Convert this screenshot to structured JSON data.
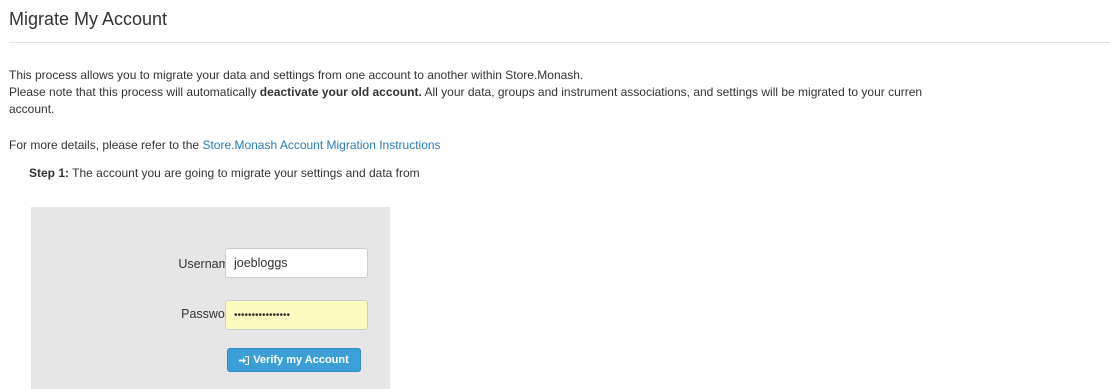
{
  "page": {
    "title": "Migrate My Account"
  },
  "intro": {
    "line1": "This process allows you to migrate your data and settings from one account to another within Store.Monash.",
    "line2_before": "Please note that this process will automatically ",
    "line2_bold": "deactivate your old account.",
    "line2_after": " All your data, groups and instrument associations, and settings will be migrated to your curren",
    "line3": "account."
  },
  "details": {
    "prefix": "For more details, please refer to the ",
    "link_text": "Store.Monash Account Migration Instructions"
  },
  "step": {
    "label": "Step 1:",
    "text": " The account you are going to migrate your settings and data from"
  },
  "form": {
    "username_label": "Username",
    "username_value": "joebloggs",
    "password_label": "Password",
    "password_value": "mypassword12345!",
    "submit_label": "Verify my Account",
    "submit_icon": "sign-in-icon"
  },
  "colors": {
    "link": "#2a7ab8",
    "button": "#3c9fd5",
    "autofill": "#fbfbbf",
    "panel": "#e6e6e6"
  }
}
